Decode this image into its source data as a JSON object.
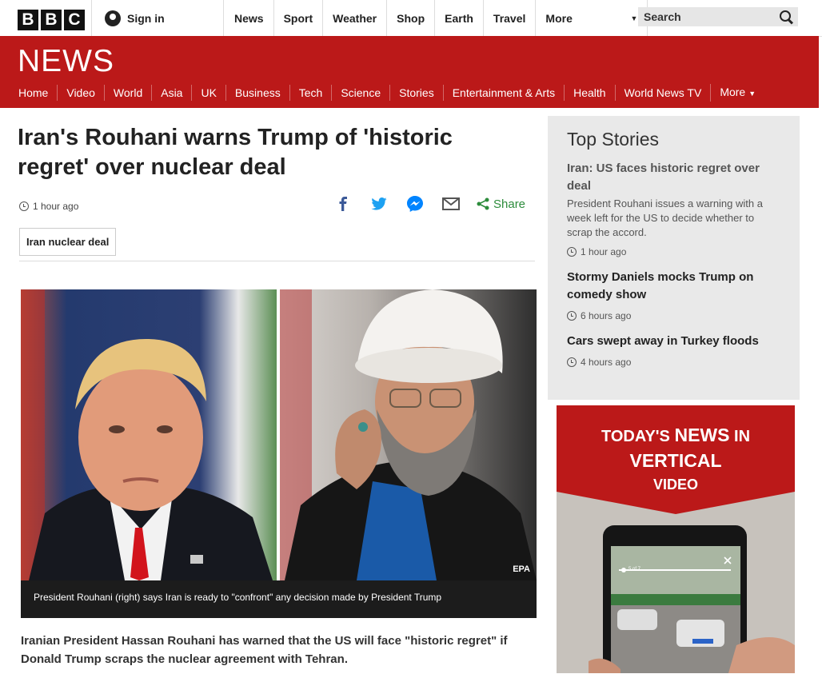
{
  "header": {
    "logo_letters": [
      "B",
      "B",
      "C"
    ],
    "signin_label": "Sign in",
    "nav": [
      "News",
      "Sport",
      "Weather",
      "Shop",
      "Earth",
      "Travel"
    ],
    "more_label": "More",
    "search_placeholder": "Search"
  },
  "banner": {
    "wordmark": "NEWS",
    "subnav": [
      "Home",
      "Video",
      "World",
      "Asia",
      "UK",
      "Business",
      "Tech",
      "Science",
      "Stories",
      "Entertainment & Arts",
      "Health",
      "World News TV"
    ],
    "more_label": "More"
  },
  "article": {
    "headline": "Iran's Rouhani warns Trump of 'historic regret' over nuclear deal",
    "timestamp": "1 hour ago",
    "share_label": "Share",
    "tag": "Iran nuclear deal",
    "image_credit": "EPA",
    "caption": "President Rouhani (right) says Iran is ready to \"confront\" any decision made by President Trump",
    "lead": "Iranian President Hassan Rouhani has warned that the US will face \"historic regret\" if Donald Trump scraps the nuclear agreement with Tehran."
  },
  "sidebar": {
    "title": "Top Stories",
    "stories": [
      {
        "title": "Iran: US faces historic regret over deal",
        "summary": "President Rouhani issues a warning with a week left for the US to decide whether to scrap the accord.",
        "time": "1 hour ago"
      },
      {
        "title": "Stormy Daniels mocks Trump on comedy show",
        "time": "6 hours ago"
      },
      {
        "title": "Cars swept away in Turkey floods",
        "time": "4 hours ago"
      }
    ],
    "promo": {
      "line1_a": "TODAY'S ",
      "line1_b": "NEWS",
      "line1_c": " IN",
      "line2": "VERTICAL",
      "line3": "VIDEO",
      "phone_counter": "5 of 7"
    }
  },
  "colors": {
    "brand_red": "#bb1919",
    "share_green": "#2d8c3c",
    "facebook": "#3b5998",
    "twitter": "#1da1f2",
    "messenger": "#0084ff"
  }
}
